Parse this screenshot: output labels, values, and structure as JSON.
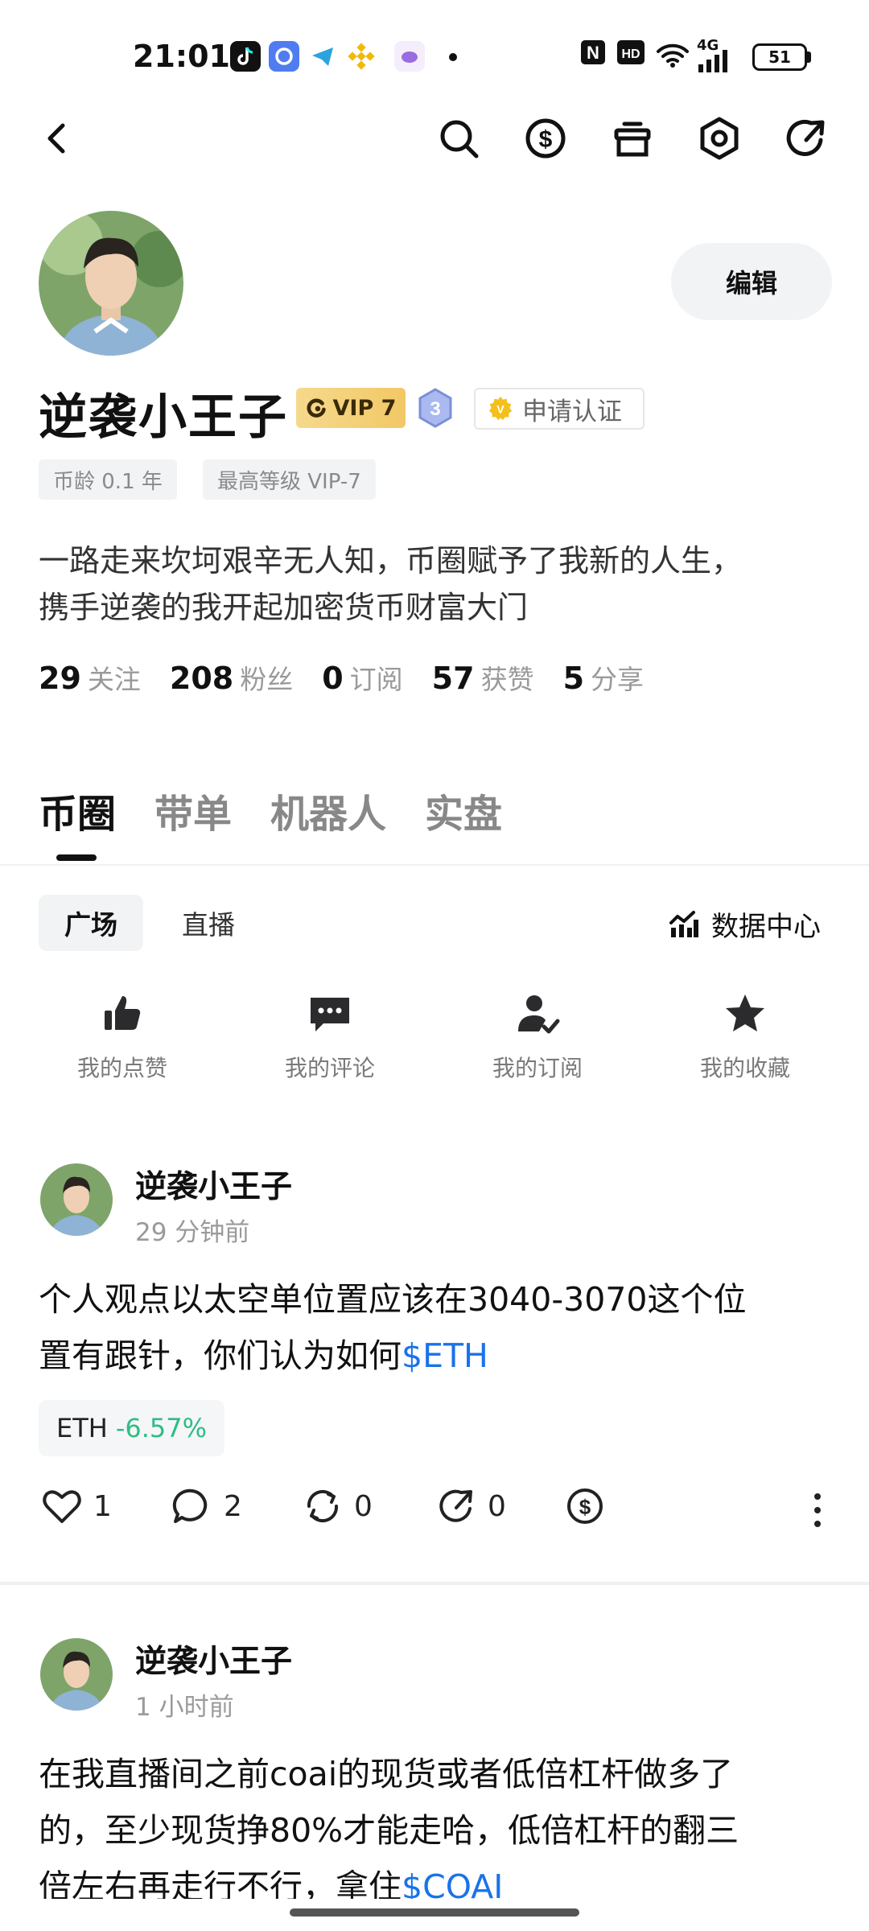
{
  "status_bar": {
    "time": "21:01",
    "app_icons": [
      "tiktok-icon",
      "browser-icon",
      "telegram-icon",
      "binance-icon",
      "app-icon",
      "more-dot-icon"
    ],
    "nfc": "N",
    "hd": "HD",
    "network": "4G",
    "battery": "51"
  },
  "nav": {
    "icons": [
      "back-arrow-icon",
      "search-icon",
      "dollar-icon",
      "gift-icon",
      "settings-icon",
      "share-icon"
    ]
  },
  "profile": {
    "edit_label": "编辑",
    "name": "逆袭小王子",
    "vip_label": "VIP 7",
    "level": "3",
    "cert_label": "申请认证",
    "tags": [
      "币龄 0.1 年",
      "最高等级 VIP-7"
    ],
    "bio_line1": "一路走来坎坷艰辛无人知，币圈赋予了我新的人生，",
    "bio_line2": "携手逆袭的我开起加密货币财富大门",
    "stats": [
      {
        "num": "29",
        "label": "关注"
      },
      {
        "num": "208",
        "label": "粉丝"
      },
      {
        "num": "0",
        "label": "订阅"
      },
      {
        "num": "57",
        "label": "获赞"
      },
      {
        "num": "5",
        "label": "分享"
      }
    ]
  },
  "main_tabs": [
    "币圈",
    "带单",
    "机器人",
    "实盘"
  ],
  "sub_tabs": [
    "广场",
    "直播"
  ],
  "data_center_label": "数据中心",
  "quick_actions": [
    "我的点赞",
    "我的评论",
    "我的订阅",
    "我的收藏"
  ],
  "posts": [
    {
      "author": "逆袭小王子",
      "time": "29 分钟前",
      "line1": "个人观点以太空单位置应该在3040-3070这个位",
      "line2_text": "置有跟针，你们认为如何",
      "line2_tag": "$ETH",
      "ticker_symbol": "ETH",
      "ticker_change": "-6.57%",
      "likes": "1",
      "comments": "2",
      "reposts": "0",
      "shares": "0"
    },
    {
      "author": "逆袭小王子",
      "time": "1 小时前",
      "line1": "在我直播间之前coai的现货或者低倍杠杆做多了",
      "line2": "的，至少现货挣80%才能走哈，低倍杠杆的翻三",
      "line3_text": "倍左右再走行不行，拿住",
      "line3_tag": "$COAI"
    }
  ],
  "colors": {
    "accent_blue": "#1a73e8",
    "positive_green": "#2ebd85",
    "vip_gold": "#f2c865",
    "level_badge": "#8aa0e6"
  }
}
